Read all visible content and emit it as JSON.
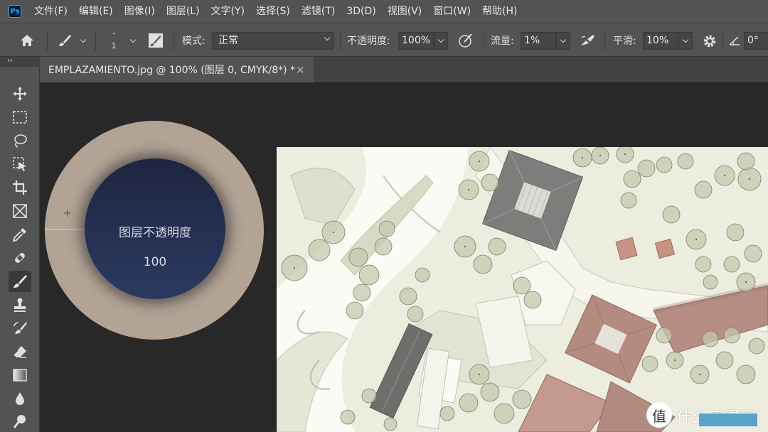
{
  "app": {
    "logo": "Ps"
  },
  "menu": [
    "文件(F)",
    "编辑(E)",
    "图像(I)",
    "图层(L)",
    "文字(Y)",
    "选择(S)",
    "滤镜(T)",
    "3D(D)",
    "视图(V)",
    "窗口(W)",
    "帮助(H)"
  ],
  "options": {
    "brush_size": "1",
    "mode_label": "模式:",
    "mode_value": "正常",
    "opacity_label": "不透明度:",
    "opacity_value": "100%",
    "flow_label": "流量:",
    "flow_value": "1%",
    "smooth_label": "平滑:",
    "smooth_value": "10%",
    "angle_value": "0°"
  },
  "panel": {
    "collapse_glyph": "››"
  },
  "tools": [
    "move-icon",
    "marquee-icon",
    "lasso-icon",
    "object-select-icon",
    "crop-icon",
    "frame-icon",
    "eyedropper-icon",
    "healing-brush-icon",
    "brush-icon",
    "clone-stamp-icon",
    "history-brush-icon",
    "eraser-icon",
    "gradient-icon",
    "blur-icon",
    "dodge-icon"
  ],
  "document": {
    "tab_title": "EMPLAZAMIENTO.jpg @ 100% (图层 0, CMYK/8*) *",
    "close_glyph": "×"
  },
  "hud": {
    "label": "图层不透明度",
    "value": "100",
    "plus": "+"
  },
  "watermark": {
    "glyph": "值",
    "text": "什么值得买"
  },
  "colors": {
    "ui_bg": "#535353",
    "canvas_bg": "#282828",
    "hud_ring": "#b2a394",
    "hud_center": "#2a3a60"
  }
}
